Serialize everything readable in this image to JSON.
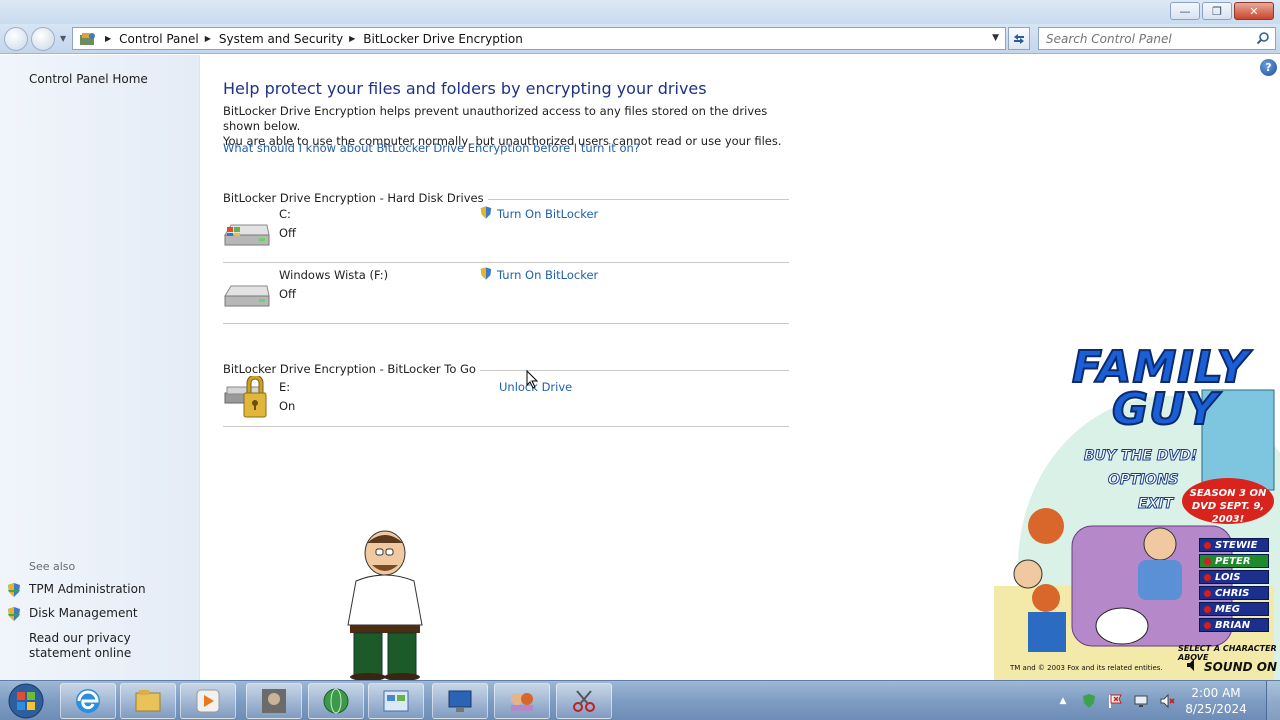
{
  "window": {
    "controls": {
      "minimize": "—",
      "maximize": "❐",
      "close": "✕"
    }
  },
  "navigation": {
    "breadcrumb": [
      "Control Panel",
      "System and Security",
      "BitLocker Drive Encryption"
    ],
    "search_placeholder": "Search Control Panel"
  },
  "sidebar": {
    "home": "Control Panel Home",
    "see_also_label": "See also",
    "links": [
      "TPM Administration",
      "Disk Management"
    ],
    "privacy": "Read our privacy statement online"
  },
  "main": {
    "help": "?",
    "heading": "Help protect your files and folders by encrypting your drives",
    "description_1": "BitLocker Drive Encryption helps prevent unauthorized access to any files stored on the drives shown below.",
    "description_2": "You are able to use the computer normally, but unauthorized users cannot read or use your files.",
    "learn_link": "What should I know about BitLocker Drive Encryption before I turn it on?",
    "hard_disk_section": "BitLocker Drive Encryption - Hard Disk Drives",
    "to_go_section": "BitLocker Drive Encryption - BitLocker To Go",
    "drives": [
      {
        "name": "C:",
        "status": "Off",
        "action": "Turn On BitLocker"
      },
      {
        "name": "Windows Wista (F:)",
        "status": "Off",
        "action": "Turn On BitLocker"
      }
    ],
    "to_go_drives": [
      {
        "name": "E:",
        "status": "On",
        "action": "Unlock Drive"
      }
    ]
  },
  "overlay": {
    "title_1": "FAMILY",
    "title_2": "GUY",
    "menu": [
      "BUY THE DVD!",
      "OPTIONS",
      "EXIT"
    ],
    "badge": "SEASON 3 ON DVD SEPT. 9, 2003!",
    "characters": [
      "STEWIE",
      "PETER",
      "LOIS",
      "CHRIS",
      "MEG",
      "BRIAN"
    ],
    "selected_character": "PETER",
    "select_prompt": "SELECT A CHARACTER ABOVE",
    "sound": "SOUND ON",
    "copyright": "TM and © 2003 Fox and its related entities."
  },
  "taskbar": {
    "time": "2:00 AM",
    "date": "8/25/2024"
  }
}
